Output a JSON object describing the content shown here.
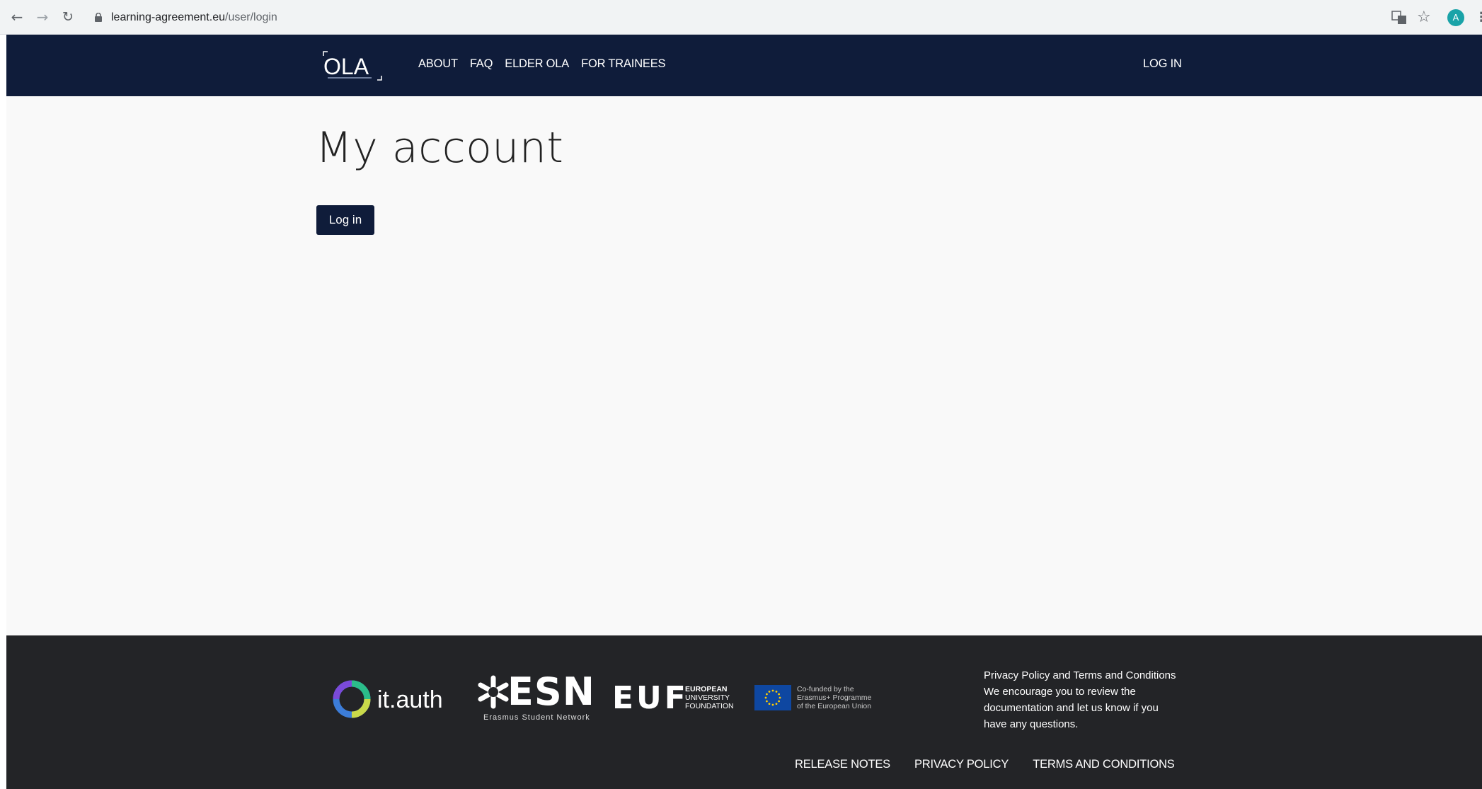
{
  "browser": {
    "url_host": "learning-agreement.eu",
    "url_path": "/user/login",
    "avatar_letter": "A"
  },
  "header": {
    "logo_text": "OLA",
    "nav": [
      {
        "label": "ABOUT"
      },
      {
        "label": "FAQ"
      },
      {
        "label": "ELDER OLA"
      },
      {
        "label": "FOR TRAINEES"
      }
    ],
    "login_label": "LOG IN"
  },
  "main": {
    "title": "My account",
    "login_button": "Log in"
  },
  "footer": {
    "partners": {
      "ithauth": "it.auth",
      "esn": "ESN",
      "esn_sub": "Erasmus Student Network",
      "euf": "EUF",
      "euf_sub": [
        "EUROPEAN",
        "UNIVERSITY",
        "FOUNDATION"
      ],
      "eu_text": [
        "Co-funded by the",
        "Erasmus+ Programme",
        "of the European Union"
      ]
    },
    "notice": [
      "Privacy Policy and Terms and Conditions",
      "We encourage you to review the",
      "documentation and let us know if you",
      "have any questions."
    ],
    "links": [
      {
        "label": "RELEASE NOTES"
      },
      {
        "label": "PRIVACY POLICY"
      },
      {
        "label": "TERMS AND CONDITIONS"
      }
    ]
  },
  "colors": {
    "navy": "#0f1c3a",
    "footer_bg": "#232427",
    "page_bg": "#f9f9f9"
  },
  "icons": [
    "back-arrow-icon",
    "forward-arrow-icon",
    "reload-icon",
    "lock-icon",
    "translate-icon",
    "star-icon",
    "menu-icon"
  ]
}
